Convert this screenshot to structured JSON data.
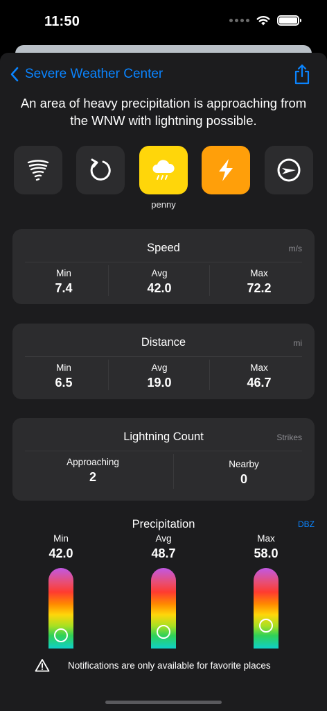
{
  "status": {
    "time": "11:50"
  },
  "nav": {
    "back_label": "Severe Weather Center"
  },
  "headline": "An area of heavy precipitation is approaching from the WNW with lightning possible.",
  "tiles": [
    {
      "icon": "tornado-icon",
      "active": false,
      "label": ""
    },
    {
      "icon": "rotation-icon",
      "active": false,
      "label": ""
    },
    {
      "icon": "storm-cloud-icon",
      "active": true,
      "color": "#ffd60a",
      "label": "penny"
    },
    {
      "icon": "lightning-bolt-icon",
      "active": true,
      "color": "#ff9f0a",
      "label": ""
    },
    {
      "icon": "direction-arrow-icon",
      "active": false,
      "label": ""
    }
  ],
  "speed": {
    "title": "Speed",
    "unit": "m/s",
    "min_label": "Min",
    "min": "7.4",
    "avg_label": "Avg",
    "avg": "42.0",
    "max_label": "Max",
    "max": "72.2"
  },
  "distance": {
    "title": "Distance",
    "unit": "mi",
    "min_label": "Min",
    "min": "6.5",
    "avg_label": "Avg",
    "avg": "19.0",
    "max_label": "Max",
    "max": "46.7"
  },
  "lightning": {
    "title": "Lightning Count",
    "unit": "Strikes",
    "approaching_label": "Approaching",
    "approaching": "2",
    "nearby_label": "Nearby",
    "nearby": "0"
  },
  "precipitation": {
    "title": "Precipitation",
    "unit": "DBZ",
    "min_label": "Min",
    "min": "42.0",
    "avg_label": "Avg",
    "avg": "48.7",
    "max_label": "Max",
    "max": "58.0",
    "levels": {
      "min": 0.07,
      "avg": 0.13,
      "max": 0.22
    }
  },
  "notice": "Notifications are only available for favorite places",
  "colors": {
    "accent": "#0a84ff",
    "sheet": "#1c1c1e",
    "card": "#2c2c2e",
    "yellow": "#ffd60a",
    "orange": "#ff9f0a"
  }
}
